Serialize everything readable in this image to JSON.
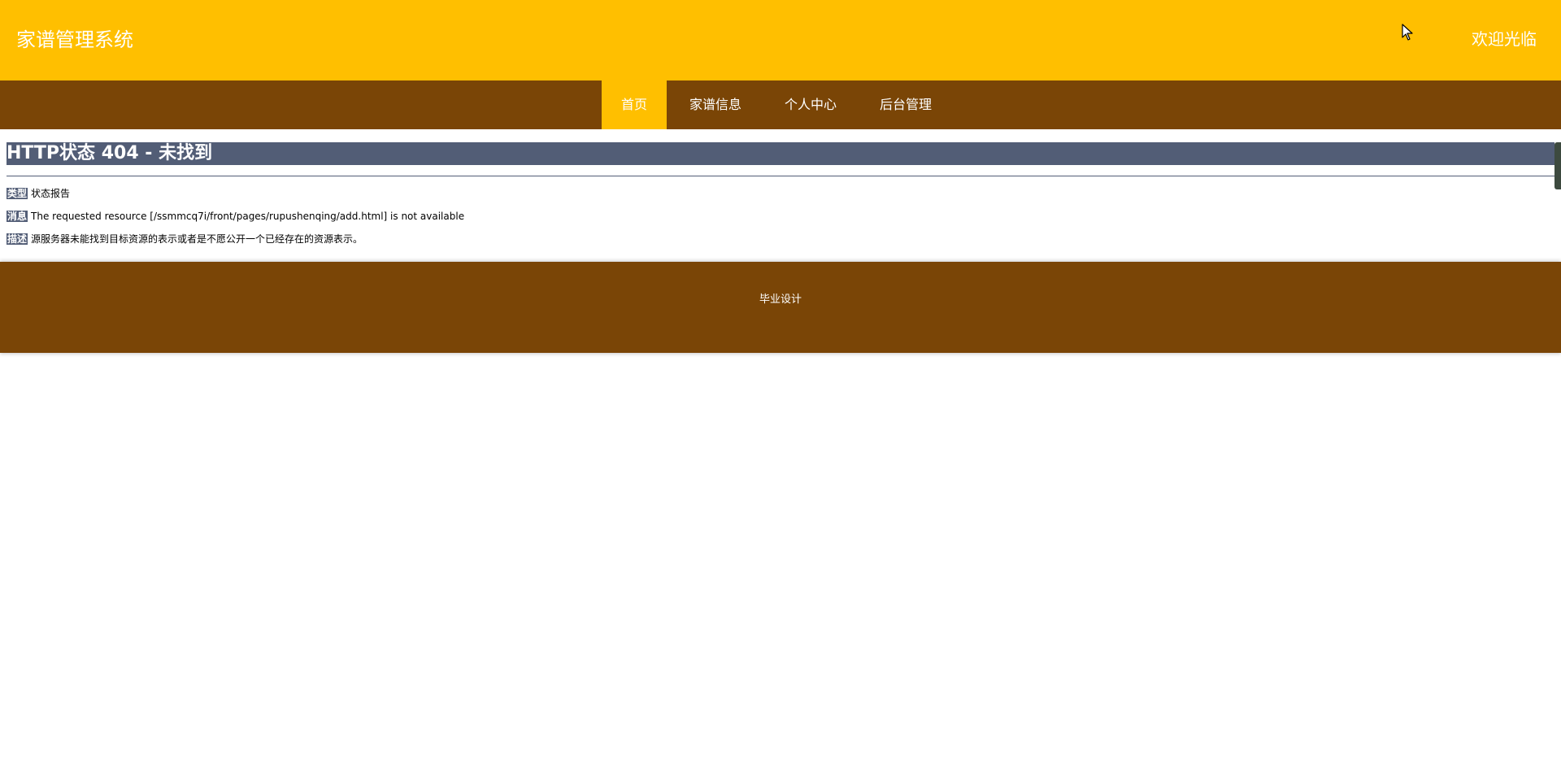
{
  "header": {
    "site_title": "家谱管理系统",
    "welcome_text": "欢迎光临"
  },
  "nav": {
    "items": [
      {
        "label": "首页",
        "active": true
      },
      {
        "label": "家谱信息",
        "active": false
      },
      {
        "label": "个人中心",
        "active": false
      },
      {
        "label": "后台管理",
        "active": false
      }
    ]
  },
  "error": {
    "title": "HTTP状态 404 - 未找到",
    "type_label": "类型",
    "type_value": "状态报告",
    "message_label": "消息",
    "message_value": "The requested resource [/ssmmcq7i/front/pages/rupushenqing/add.html] is not available",
    "description_label": "描述",
    "description_value": "源服务器未能找到目标资源的表示或者是不愿公开一个已经存在的资源表示。"
  },
  "footer": {
    "text": "毕业设计"
  },
  "colors": {
    "header_bg": "#FFBF00",
    "nav_bg": "#7A4506",
    "nav_active_bg": "#FFBF00",
    "error_bar_bg": "#525D76",
    "footer_bg": "#7A4506"
  }
}
